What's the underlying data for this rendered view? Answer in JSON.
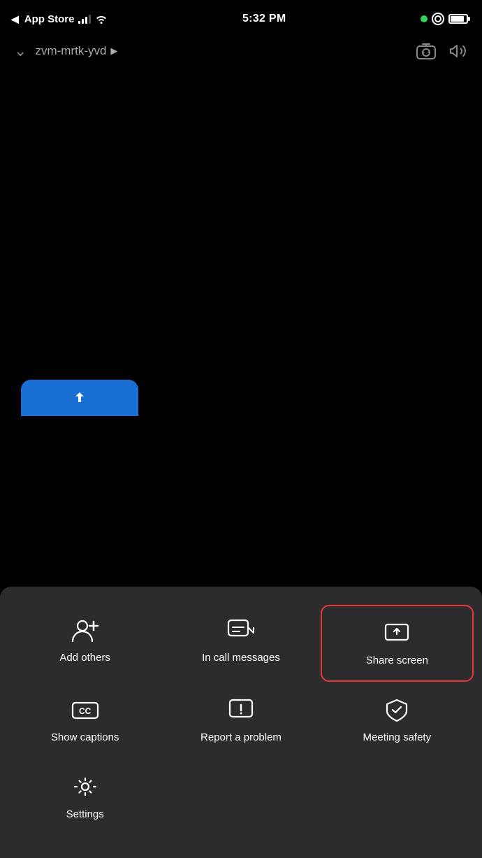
{
  "statusBar": {
    "carrier": "App Store",
    "time": "5:32 PM",
    "back_arrow": "◀"
  },
  "header": {
    "chevron": "⌄",
    "meetingId": "zvm-mrtk-yvd",
    "arrow": "▶"
  },
  "menu": {
    "items": [
      {
        "id": "add-others",
        "label": "Add others",
        "highlighted": false
      },
      {
        "id": "in-call-messages",
        "label": "In call messages",
        "highlighted": false
      },
      {
        "id": "share-screen",
        "label": "Share screen",
        "highlighted": true
      },
      {
        "id": "show-captions",
        "label": "Show captions",
        "highlighted": false
      },
      {
        "id": "report-problem",
        "label": "Report a problem",
        "highlighted": false
      },
      {
        "id": "meeting-safety",
        "label": "Meeting safety",
        "highlighted": false
      },
      {
        "id": "settings",
        "label": "Settings",
        "highlighted": false
      }
    ]
  }
}
